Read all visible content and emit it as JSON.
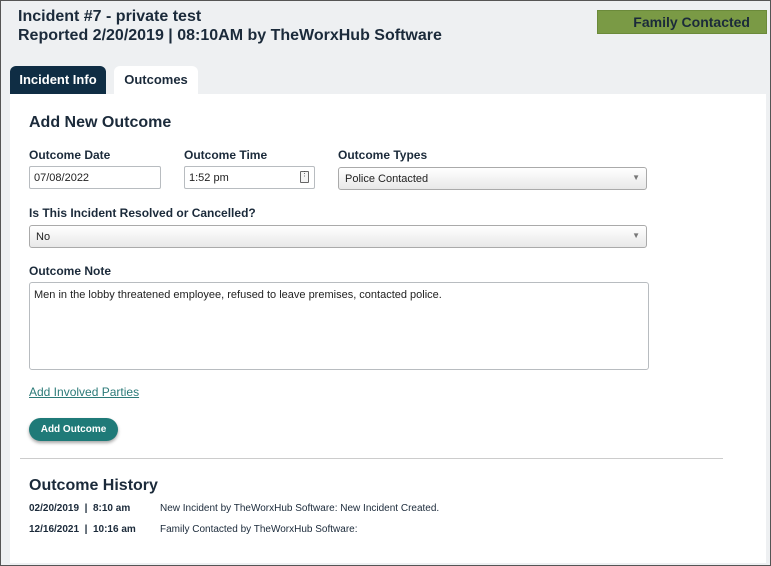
{
  "header": {
    "title_line1": "Incident #7 - private test",
    "title_line2": "Reported 2/20/2019 | 08:10AM by TheWorxHub Software",
    "status": "Family Contacted"
  },
  "tabs": [
    {
      "label": "Incident Info",
      "active": false
    },
    {
      "label": "Outcomes",
      "active": true
    }
  ],
  "form": {
    "title": "Add New Outcome",
    "outcome_date_label": "Outcome Date",
    "outcome_date_value": "07/08/2022",
    "outcome_time_label": "Outcome Time",
    "outcome_time_value": "1:52 pm",
    "outcome_types_label": "Outcome Types",
    "outcome_types_value": "Police Contacted",
    "resolved_label": "Is This Incident Resolved or Cancelled?",
    "resolved_value": "No",
    "note_label": "Outcome Note",
    "note_value": "Men in the lobby threatened employee, refused to leave premises, contacted police.",
    "add_parties_link": "Add Involved Parties",
    "add_outcome_button": "Add Outcome"
  },
  "history": {
    "title": "Outcome History",
    "rows": [
      {
        "date": "02/20/2019  |  8:10 am",
        "text": "New Incident by TheWorxHub Software: New Incident Created."
      },
      {
        "date": "12/16/2021  |  10:16 am",
        "text": "Family Contacted by TheWorxHub Software:"
      }
    ]
  },
  "colors": {
    "status_badge": "#7a9a45",
    "active_tab": "#0f2d44",
    "button": "#1f7a78",
    "link": "#2b7a78"
  }
}
